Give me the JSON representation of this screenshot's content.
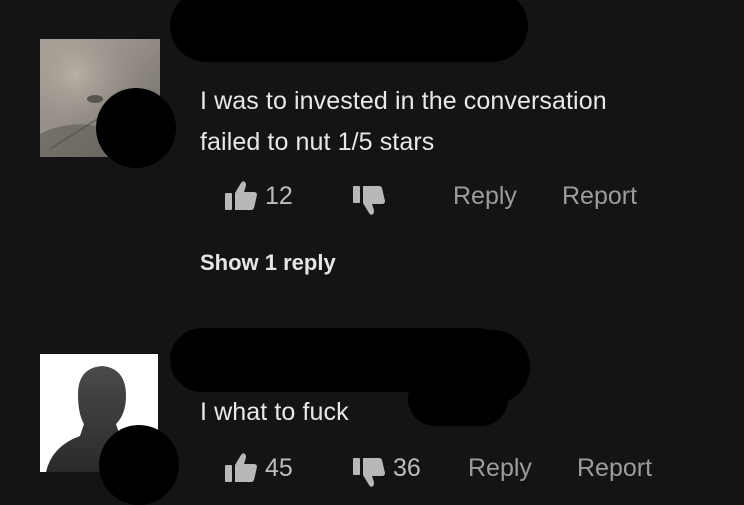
{
  "comments": [
    {
      "text_lines": [
        "I was to invested in the conversation",
        "failed to nut 1/5 stars"
      ],
      "likes": "12",
      "dislikes": "",
      "reply_label": "Reply",
      "report_label": "Report",
      "show_replies_label": "Show 1 reply"
    },
    {
      "text_lines": [
        "I what to fuck"
      ],
      "likes": "45",
      "dislikes": "36",
      "reply_label": "Reply",
      "report_label": "Report"
    }
  ],
  "icons": {
    "like": "thumbs-up-icon",
    "dislike": "thumbs-down-icon"
  },
  "colors": {
    "background": "#141414",
    "redaction": "#000000",
    "text": "#e8e8e8",
    "muted_text": "#9c9c9c"
  }
}
